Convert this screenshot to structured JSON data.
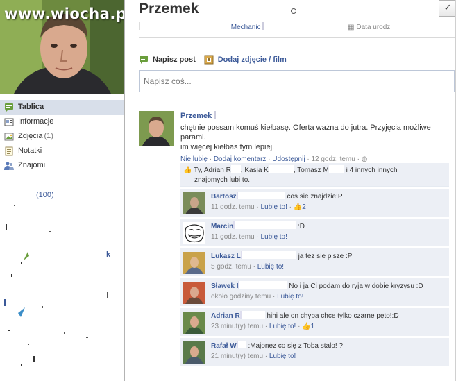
{
  "watermark": "www.wiocha.pl",
  "profile": {
    "name": "Przemek",
    "info_line": [
      "Mechanic",
      "Data urodz"
    ]
  },
  "left_nav": {
    "items": [
      {
        "label": "Tablica",
        "icon": "wall-icon",
        "count": ""
      },
      {
        "label": "Informacje",
        "icon": "info-icon",
        "count": ""
      },
      {
        "label": "Zdjęcia",
        "icon": "photos-icon",
        "count": "(1)"
      },
      {
        "label": "Notatki",
        "icon": "notes-icon",
        "count": ""
      },
      {
        "label": "Znajomi",
        "icon": "friends-icon",
        "count": ""
      }
    ],
    "partial_text": [
      "(100)",
      "k"
    ]
  },
  "composer": {
    "tab_post": "Napisz post",
    "tab_photo": "Dodaj zdjęcie / film",
    "placeholder": "Napisz coś..."
  },
  "post": {
    "author": "Przemek",
    "text_line1": "chętnie possam komuś kiełbasę. Oferta ważna do jutra. Przyjęcia możliwe parami.",
    "text_line2": "im więcej kiełbas tym lepiej.",
    "meta": {
      "unlike": "Nie lubię",
      "comment": "Dodaj komentarz",
      "share": "Udostępnij",
      "time": "12 godz. temu"
    },
    "likes": {
      "prefix": "Ty,",
      "people": [
        "Adrian R",
        "Kasia K",
        "Tomasz M"
      ],
      "others": "i 4 innych",
      "suffix_line1": "innych",
      "line2": "znajomych lubi to."
    }
  },
  "comments": [
    {
      "author": "Bartosz",
      "text": "cos sie znajdzie:P",
      "time": "11 godz. temu",
      "like": "Lubię to!",
      "likes": "2",
      "avatar": "avatar-bartosz"
    },
    {
      "author": "Marcin",
      "text": ":D",
      "time": "11 godz. temu",
      "like": "Lubię to!",
      "likes": "",
      "avatar": "avatar-trollface"
    },
    {
      "author": "Lukasz L",
      "text": "ja tez sie pisze :P",
      "time": "5 godz. temu",
      "like": "Lubię to!",
      "likes": "",
      "avatar": "avatar-lukasz"
    },
    {
      "author": "Sławek I",
      "text": "No i ja Ci podam do ryja w dobie kryzysu :D",
      "time": "około godziny temu",
      "like": "Lubię to!",
      "likes": "",
      "avatar": "avatar-slawek"
    },
    {
      "author": "Adrian R",
      "text": "hihi ale on chyba chce tylko czarne pęto!:D",
      "time": "23 minut(y) temu",
      "like": "Lubię to!",
      "likes": "1",
      "avatar": "avatar-adrian"
    },
    {
      "author": "Rafał W",
      "text": ":Majonez co się z Toba stalo! ?",
      "time": "21 minut(y) temu",
      "like": "Lubię to!",
      "likes": "",
      "avatar": "avatar-rafal"
    }
  ],
  "colors": {
    "link": "#3b5998",
    "active_nav_bg": "#d8dfea",
    "comment_bg": "#eceff5"
  }
}
